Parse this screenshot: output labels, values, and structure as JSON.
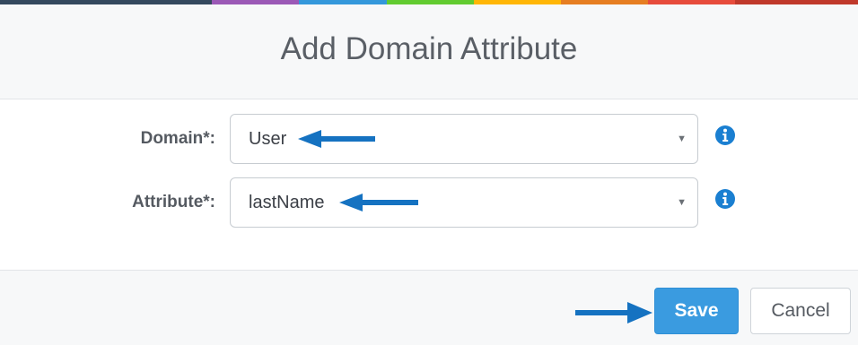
{
  "header": {
    "title": "Add Domain Attribute"
  },
  "form": {
    "domain": {
      "label": "Domain*:",
      "value": "User"
    },
    "attribute": {
      "label": "Attribute*:",
      "value": "lastName"
    },
    "caret_glyph": "▼",
    "info_icon": "info-circle-icon"
  },
  "footer": {
    "save_label": "Save",
    "cancel_label": "Cancel"
  },
  "colors": {
    "top_stripe": [
      "#34495e",
      "#9b59b6",
      "#3498db",
      "#62cb31",
      "#ffb606",
      "#e67e22",
      "#e74c3c",
      "#c0392b"
    ],
    "save_button": "#3a9be0",
    "annotation_arrow": "#1572c1",
    "info_icon": "#1a7fd1"
  },
  "annotations": {
    "arrow_icon": "left-right-pointer-arrow-icon"
  }
}
